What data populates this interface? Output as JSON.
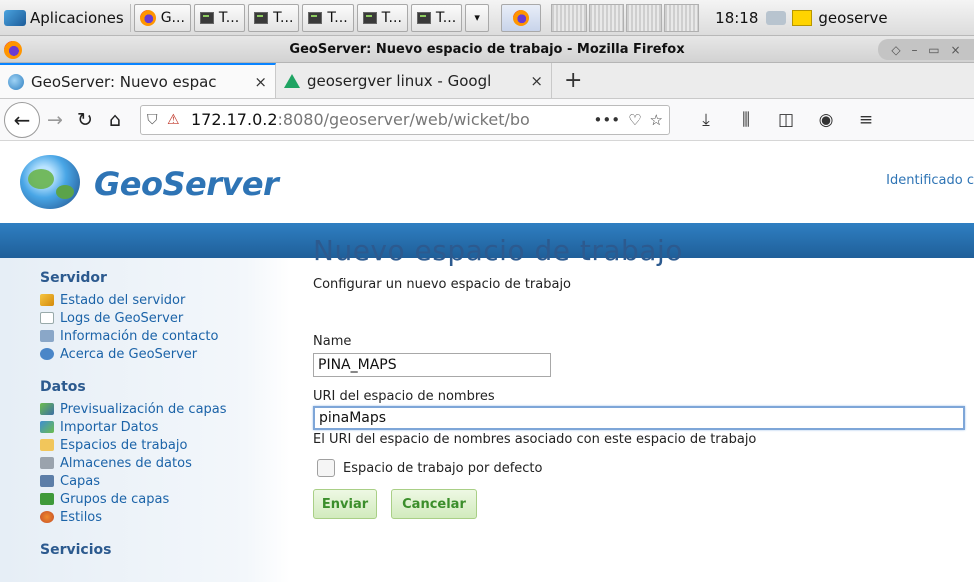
{
  "taskbar": {
    "apps_label": "Aplicaciones",
    "windows": [
      {
        "label": "G...",
        "icon": "firefox-icon"
      },
      {
        "label": "T...",
        "icon": "terminal-icon"
      },
      {
        "label": "T...",
        "icon": "terminal-icon"
      },
      {
        "label": "T...",
        "icon": "terminal-icon"
      },
      {
        "label": "T...",
        "icon": "terminal-icon"
      },
      {
        "label": "T...",
        "icon": "terminal-icon"
      }
    ],
    "clock": "18:18",
    "user": "geoserve"
  },
  "window": {
    "title": "GeoServer: Nuevo espacio de trabajo - Mozilla Firefox"
  },
  "tabs": [
    {
      "label": "GeoServer: Nuevo espac",
      "close": "×",
      "active": true
    },
    {
      "label": "geosergver linux - Googl",
      "close": "×",
      "active": false
    }
  ],
  "newtab": "+",
  "url": {
    "host": "172.17.0.2",
    "path": ":8080/geoserver/web/wicket/bo",
    "actions": "•••"
  },
  "gs": {
    "brand": "GeoServer",
    "login_text": "Identificado c"
  },
  "sidebar": {
    "sections": [
      {
        "title": "Servidor",
        "items": [
          {
            "label": "Estado del servidor",
            "icon": "warning-icon"
          },
          {
            "label": "Logs de GeoServer",
            "icon": "document-icon"
          },
          {
            "label": "Información de contacto",
            "icon": "contact-card-icon"
          },
          {
            "label": "Acerca de GeoServer",
            "icon": "info-icon"
          }
        ]
      },
      {
        "title": "Datos",
        "items": [
          {
            "label": "Previsualización de capas",
            "icon": "layer-preview-icon"
          },
          {
            "label": "Importar Datos",
            "icon": "import-icon"
          },
          {
            "label": "Espacios de trabajo",
            "icon": "folder-icon"
          },
          {
            "label": "Almacenes de datos",
            "icon": "datastore-icon"
          },
          {
            "label": "Capas",
            "icon": "layers-icon"
          },
          {
            "label": "Grupos de capas",
            "icon": "layer-group-icon"
          },
          {
            "label": "Estilos",
            "icon": "style-icon"
          }
        ]
      },
      {
        "title": "Servicios",
        "items": []
      }
    ]
  },
  "form": {
    "title": "Nuevo espacio de trabajo",
    "description": "Configurar un nuevo espacio de trabajo",
    "name_label": "Name",
    "name_value": "PINA_MAPS",
    "uri_label": "URI del espacio de nombres",
    "uri_value": "pinaMaps",
    "uri_help": "El URI del espacio de nombres asociado con este espacio de trabajo",
    "default_label": "Espacio de trabajo por defecto",
    "default_checked": false,
    "submit_label": "Enviar",
    "cancel_label": "Cancelar"
  },
  "colors": {
    "brand_blue": "#2e74b5",
    "band_blue": "#1f5f99",
    "button_green": "#3b8e2b"
  }
}
